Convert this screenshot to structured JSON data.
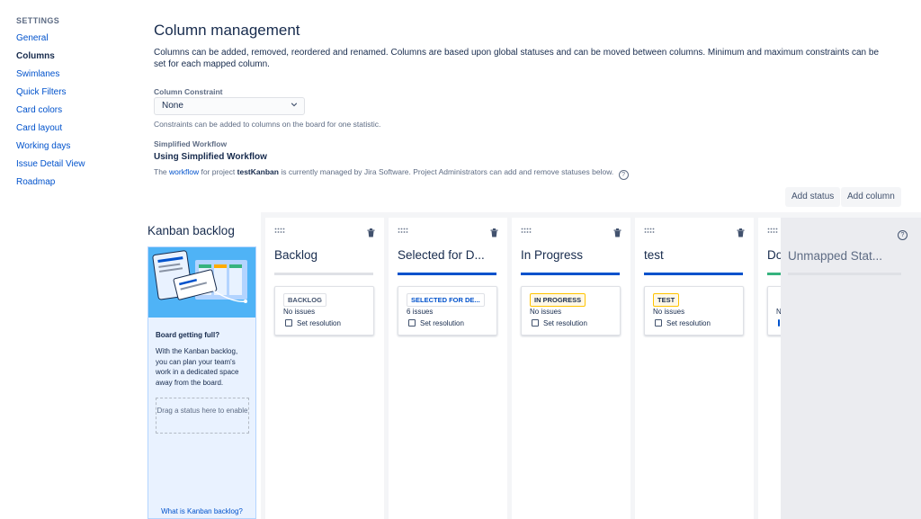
{
  "sidebar": {
    "heading": "SETTINGS",
    "items": [
      {
        "label": "General"
      },
      {
        "label": "Columns"
      },
      {
        "label": "Swimlanes"
      },
      {
        "label": "Quick Filters"
      },
      {
        "label": "Card colors"
      },
      {
        "label": "Card layout"
      },
      {
        "label": "Working days"
      },
      {
        "label": "Issue Detail View"
      },
      {
        "label": "Roadmap"
      }
    ],
    "active": "Columns"
  },
  "header": {
    "title": "Column management",
    "description": "Columns can be added, removed, reordered and renamed. Columns are based upon global statuses and can be moved between columns. Minimum and maximum constraints can be set for each mapped column."
  },
  "constraint": {
    "label": "Column Constraint",
    "value": "None",
    "help": "Constraints can be added to columns on the board for one statistic."
  },
  "workflow": {
    "label": "Simplified Workflow",
    "title": "Using Simplified Workflow",
    "desc_prefix": "The",
    "link": "workflow",
    "desc_middle": "for project",
    "project": "testKanban",
    "desc_suffix": "is currently managed by Jira Software. Project Administrators can add and remove statuses below."
  },
  "actions": {
    "add_status": "Add status",
    "add_column": "Add column"
  },
  "backlog": {
    "title": "Kanban backlog",
    "heading": "Board getting full?",
    "text": "With the Kanban backlog, you can plan your team's work in a dedicated space away from the board.",
    "drop_zone": "Drag a status here to enable",
    "link": "What is Kanban backlog?"
  },
  "columns": [
    {
      "title": "Backlog",
      "status": "BACKLOG",
      "issues": "No issues",
      "resolution": "Set resolution",
      "bar": "grey",
      "lozenge": "grey"
    },
    {
      "title": "Selected for D...",
      "status": "SELECTED FOR DE...",
      "issues": "6 issues",
      "resolution": "Set resolution",
      "bar": "blue",
      "lozenge": "blue"
    },
    {
      "title": "In Progress",
      "status": "IN PROGRESS",
      "issues": "No issues",
      "resolution": "Set resolution",
      "bar": "blue",
      "lozenge": "yellow"
    },
    {
      "title": "test",
      "status": "TEST",
      "issues": "No issues",
      "resolution": "Set resolution",
      "bar": "blue",
      "lozenge": "yellow"
    },
    {
      "title": "Do",
      "status": "",
      "issues": "N",
      "resolution": "",
      "bar": "green",
      "lozenge": "grey"
    }
  ],
  "unmapped": {
    "title": "Unmapped Stat...",
    "help": "?"
  },
  "colors": {
    "link": "#0052cc",
    "text": "#172b4d",
    "subtle": "#5e6c84",
    "in_progress_bar": "#0052cc",
    "done_bar": "#36b37e",
    "board_bg": "#f4f5f7"
  }
}
